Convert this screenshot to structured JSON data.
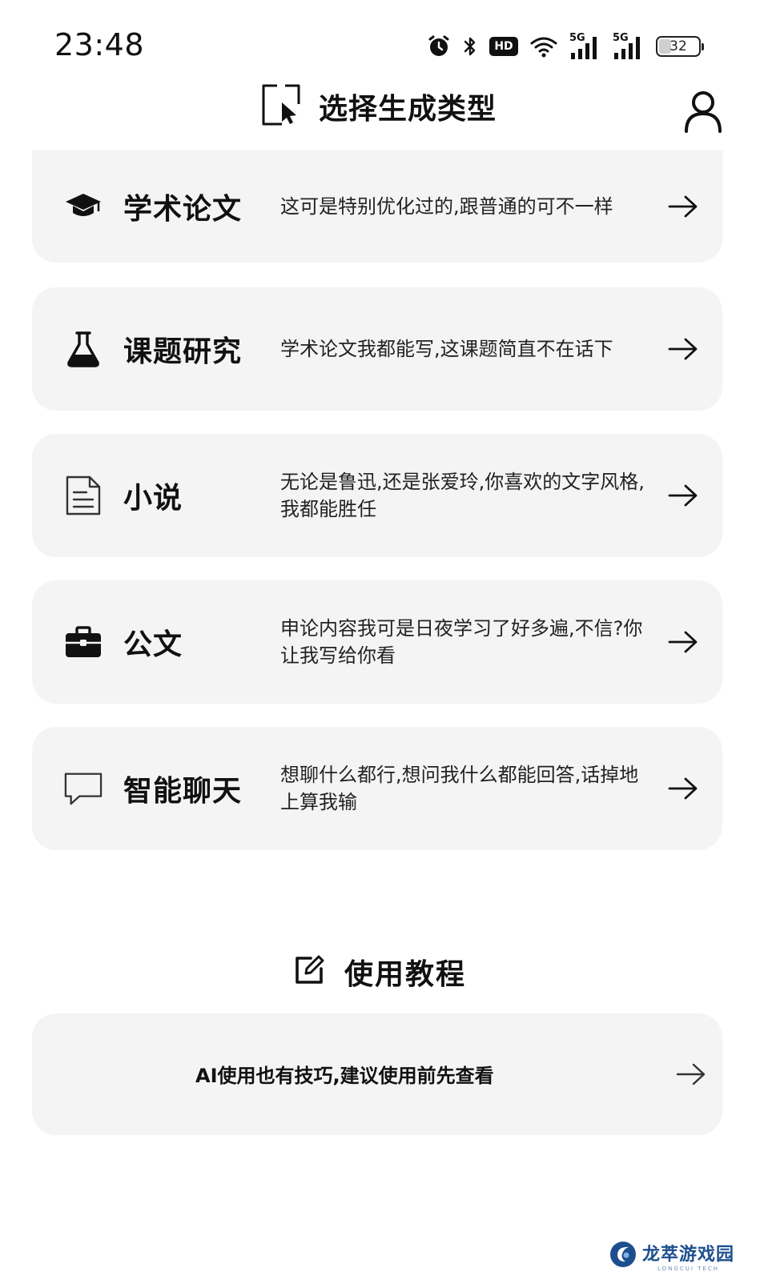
{
  "status_bar": {
    "time": "23:48",
    "battery_percent": 32,
    "battery_label": "32",
    "hd_label": "HD",
    "network_1": "5G",
    "network_2": "5G"
  },
  "header": {
    "title": "选择生成类型"
  },
  "cards": [
    {
      "title": "学术论文",
      "desc": "这可是特别优化过的,跟普通的可不一样",
      "icon": "graduation-cap-icon"
    },
    {
      "title": "课题研究",
      "desc": "学术论文我都能写,这课题简直不在话下",
      "icon": "flask-icon"
    },
    {
      "title": "小说",
      "desc": "无论是鲁迅,还是张爱玲,你喜欢的文字风格,我都能胜任",
      "icon": "document-icon"
    },
    {
      "title": "公文",
      "desc": "申论内容我可是日夜学习了好多遍,不信?你让我写给你看",
      "icon": "briefcase-icon"
    },
    {
      "title": "智能聊天",
      "desc": "想聊什么都行,想问我什么都能回答,话掉地上算我输",
      "icon": "chat-bubble-icon"
    }
  ],
  "tutorial": {
    "title": "使用教程",
    "card_text": "AI使用也有技巧,建议使用前先查看"
  },
  "watermark": {
    "name": "龙萃游戏园",
    "subtitle": "LONGCUI TECH"
  },
  "colors": {
    "card_background": "#f4f4f4",
    "text": "#111111",
    "watermark_blue": "#1d4f8f"
  }
}
